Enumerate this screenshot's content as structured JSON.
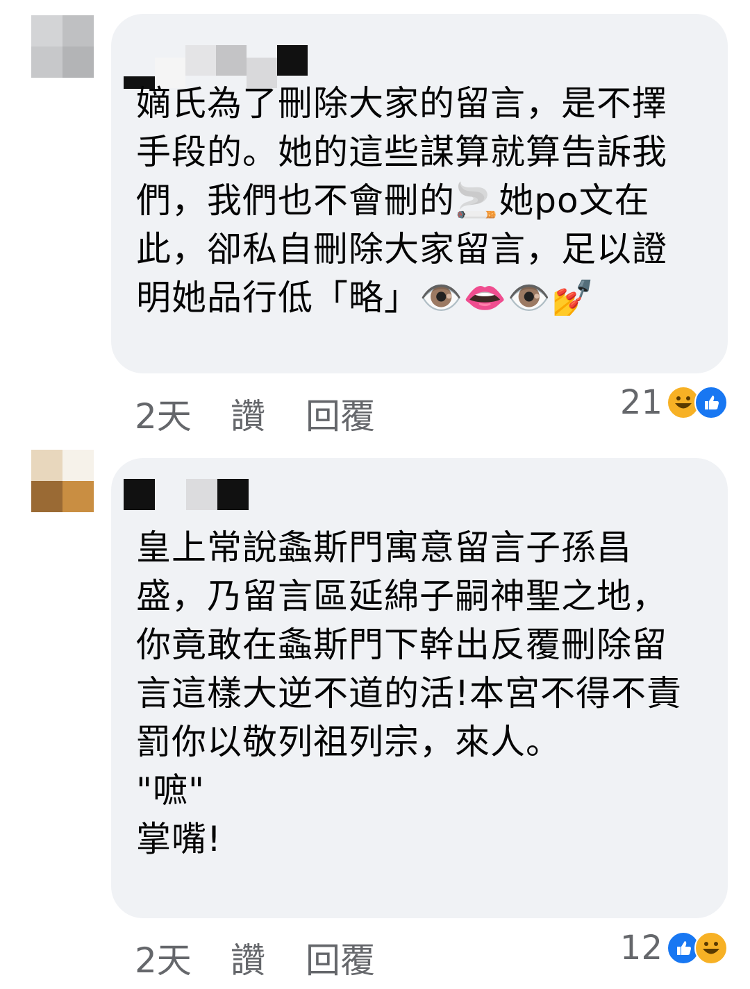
{
  "comments": [
    {
      "id": "c1",
      "text": "嫡氏為了刪除大家的留言，是不擇手段的。她的這些謀算就算告訴我們，我們也不會刪的🚬她po文在此，卻私自刪除大家留言，足以證明她品行低「略」👁️👄👁️💅",
      "time": "2天",
      "like_label": "讚",
      "reply_label": "回覆",
      "reaction_count": "21",
      "reactions": [
        "haha-icon",
        "like-icon"
      ]
    },
    {
      "id": "c2",
      "text": "皇上常說螽斯門寓意留言子孫昌盛，乃留言區延綿子嗣神聖之地，你竟敢在螽斯門下幹出反覆刪除留言這樣大逆不道的活!本宮不得不責罰你以敬列祖列宗，來人。\n\"嗻\"\n掌嘴!",
      "time": "2天",
      "like_label": "讚",
      "reply_label": "回覆",
      "reaction_count": "12",
      "reactions": [
        "like-icon",
        "haha-icon"
      ]
    }
  ],
  "colors": {
    "bubble": "#f0f2f5",
    "meta": "#65676b",
    "like_blue": "#1877f2",
    "haha_yellow": "#f7b125"
  }
}
